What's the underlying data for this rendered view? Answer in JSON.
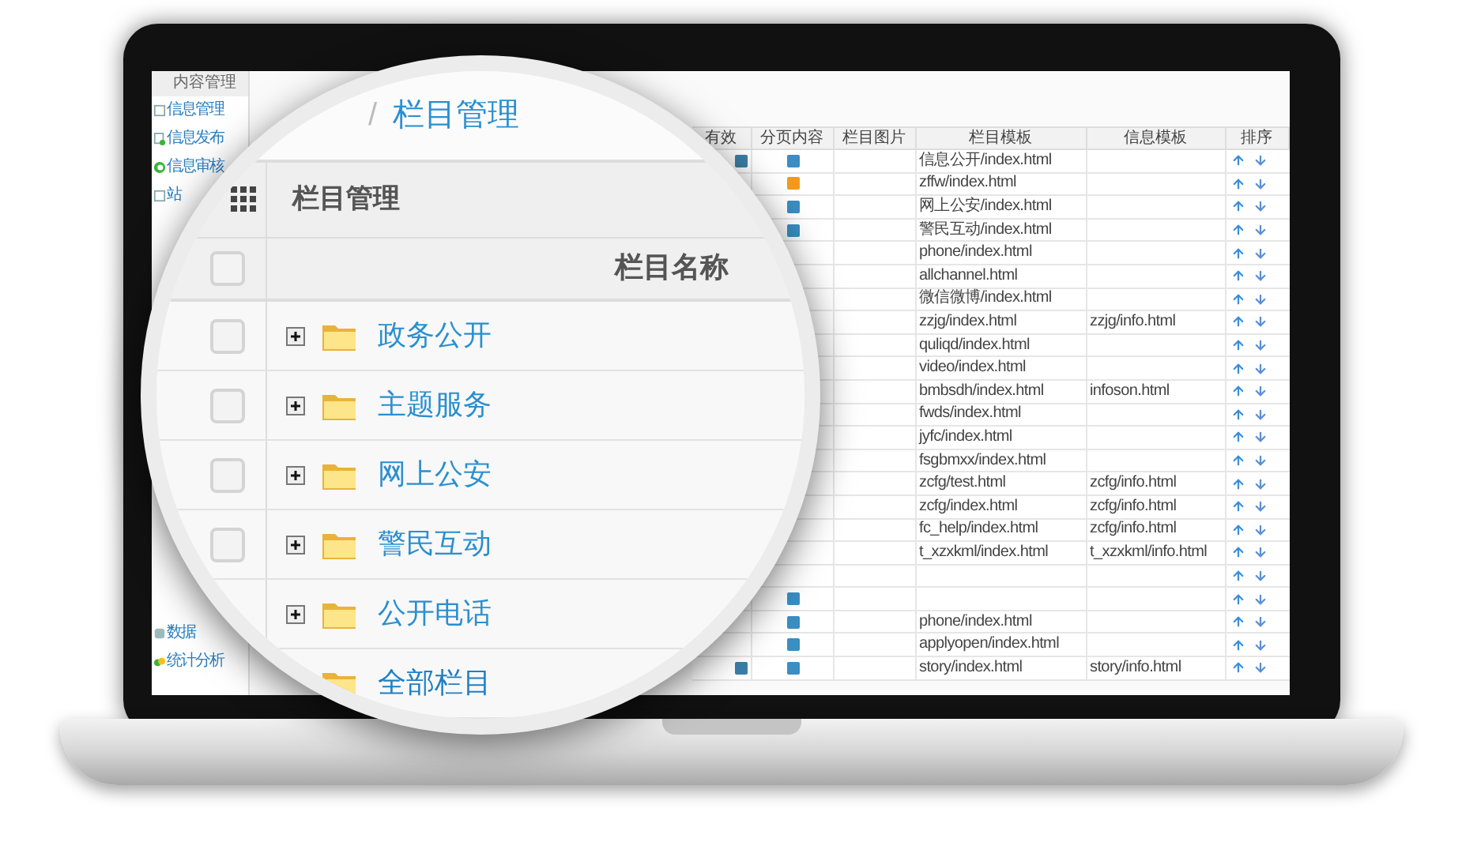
{
  "sidebar": {
    "header": "内容管理",
    "top_items": [
      {
        "label": "信息管理",
        "kind": "page"
      },
      {
        "label": "信息发布",
        "kind": "page-add"
      },
      {
        "label": "信息审核",
        "kind": "check"
      },
      {
        "label": "站",
        "kind": "page"
      }
    ],
    "bottom_items": [
      {
        "label": "数据",
        "kind": "db"
      },
      {
        "label": "统计分析",
        "kind": "chart"
      }
    ]
  },
  "table": {
    "columns": [
      "有效",
      "分页内容",
      "栏目图片",
      "栏目模板",
      "信息模板",
      "排序"
    ],
    "rows": [
      {
        "valid_icon": true,
        "color": "#3a8ec2",
        "template": "信息公开/index.html"
      },
      {
        "valid_icon": false,
        "color": "#f39a1e",
        "template": "zffw/index.html"
      },
      {
        "valid_icon": false,
        "color": "#3a8ec2",
        "template": "网上公安/index.html"
      },
      {
        "valid_icon": false,
        "color": "#3a8ec2",
        "template": "警民互动/index.html"
      },
      {
        "valid_icon": false,
        "template": "phone/index.html"
      },
      {
        "valid_icon": false,
        "template": "allchannel.html"
      },
      {
        "valid_icon": false,
        "template": "微信微博/index.html"
      },
      {
        "valid_icon": false,
        "template": "zzjg/index.html",
        "info_template": "zzjg/info.html"
      },
      {
        "valid_icon": false,
        "template": "quliqd/index.html"
      },
      {
        "valid_icon": false,
        "template": "video/index.html"
      },
      {
        "valid_icon": false,
        "template": "bmbsdh/index.html",
        "info_template": "infoson.html"
      },
      {
        "valid_icon": false,
        "template": "fwds/index.html"
      },
      {
        "valid_icon": false,
        "template": "jyfc/index.html"
      },
      {
        "valid_icon": false,
        "template": "fsgbmxx/index.html"
      },
      {
        "valid_icon": false,
        "template": "zcfg/test.html",
        "info_template": "zcfg/info.html"
      },
      {
        "valid_icon": false,
        "template": "zcfg/index.html",
        "info_template": "zcfg/info.html"
      },
      {
        "valid_icon": false,
        "template": "fc_help/index.html",
        "info_template": "zcfg/info.html"
      },
      {
        "valid_icon": false,
        "template": "t_xzxkml/index.html",
        "info_template": "t_xzxkml/info.html"
      },
      {
        "valid_icon": false
      },
      {
        "valid_icon": false,
        "color": "#3a8ec2"
      },
      {
        "valid_icon": false,
        "color": "#3a8ec2",
        "template": "phone/index.html"
      },
      {
        "valid_icon": false,
        "color": "#3a8ec2",
        "template": "applyopen/index.html"
      },
      {
        "valid_icon": true,
        "color": "#3a8ec2",
        "template": "story/index.html",
        "info_template": "story/info.html"
      }
    ]
  },
  "magnifier": {
    "separator": "/",
    "breadcrumb": "栏目管理",
    "panel_title": "栏目管理",
    "column": "栏目名称",
    "header_checked": false,
    "rows": [
      {
        "name": "政务公开",
        "checked": false,
        "expandable": true
      },
      {
        "name": "主题服务",
        "checked": false,
        "expandable": true
      },
      {
        "name": "网上公安",
        "checked": false,
        "expandable": true
      },
      {
        "name": "警民互动",
        "checked": false,
        "expandable": true
      },
      {
        "name": "公开电话",
        "expandable": true
      },
      {
        "name": "全部栏目",
        "expandable": false
      }
    ]
  }
}
